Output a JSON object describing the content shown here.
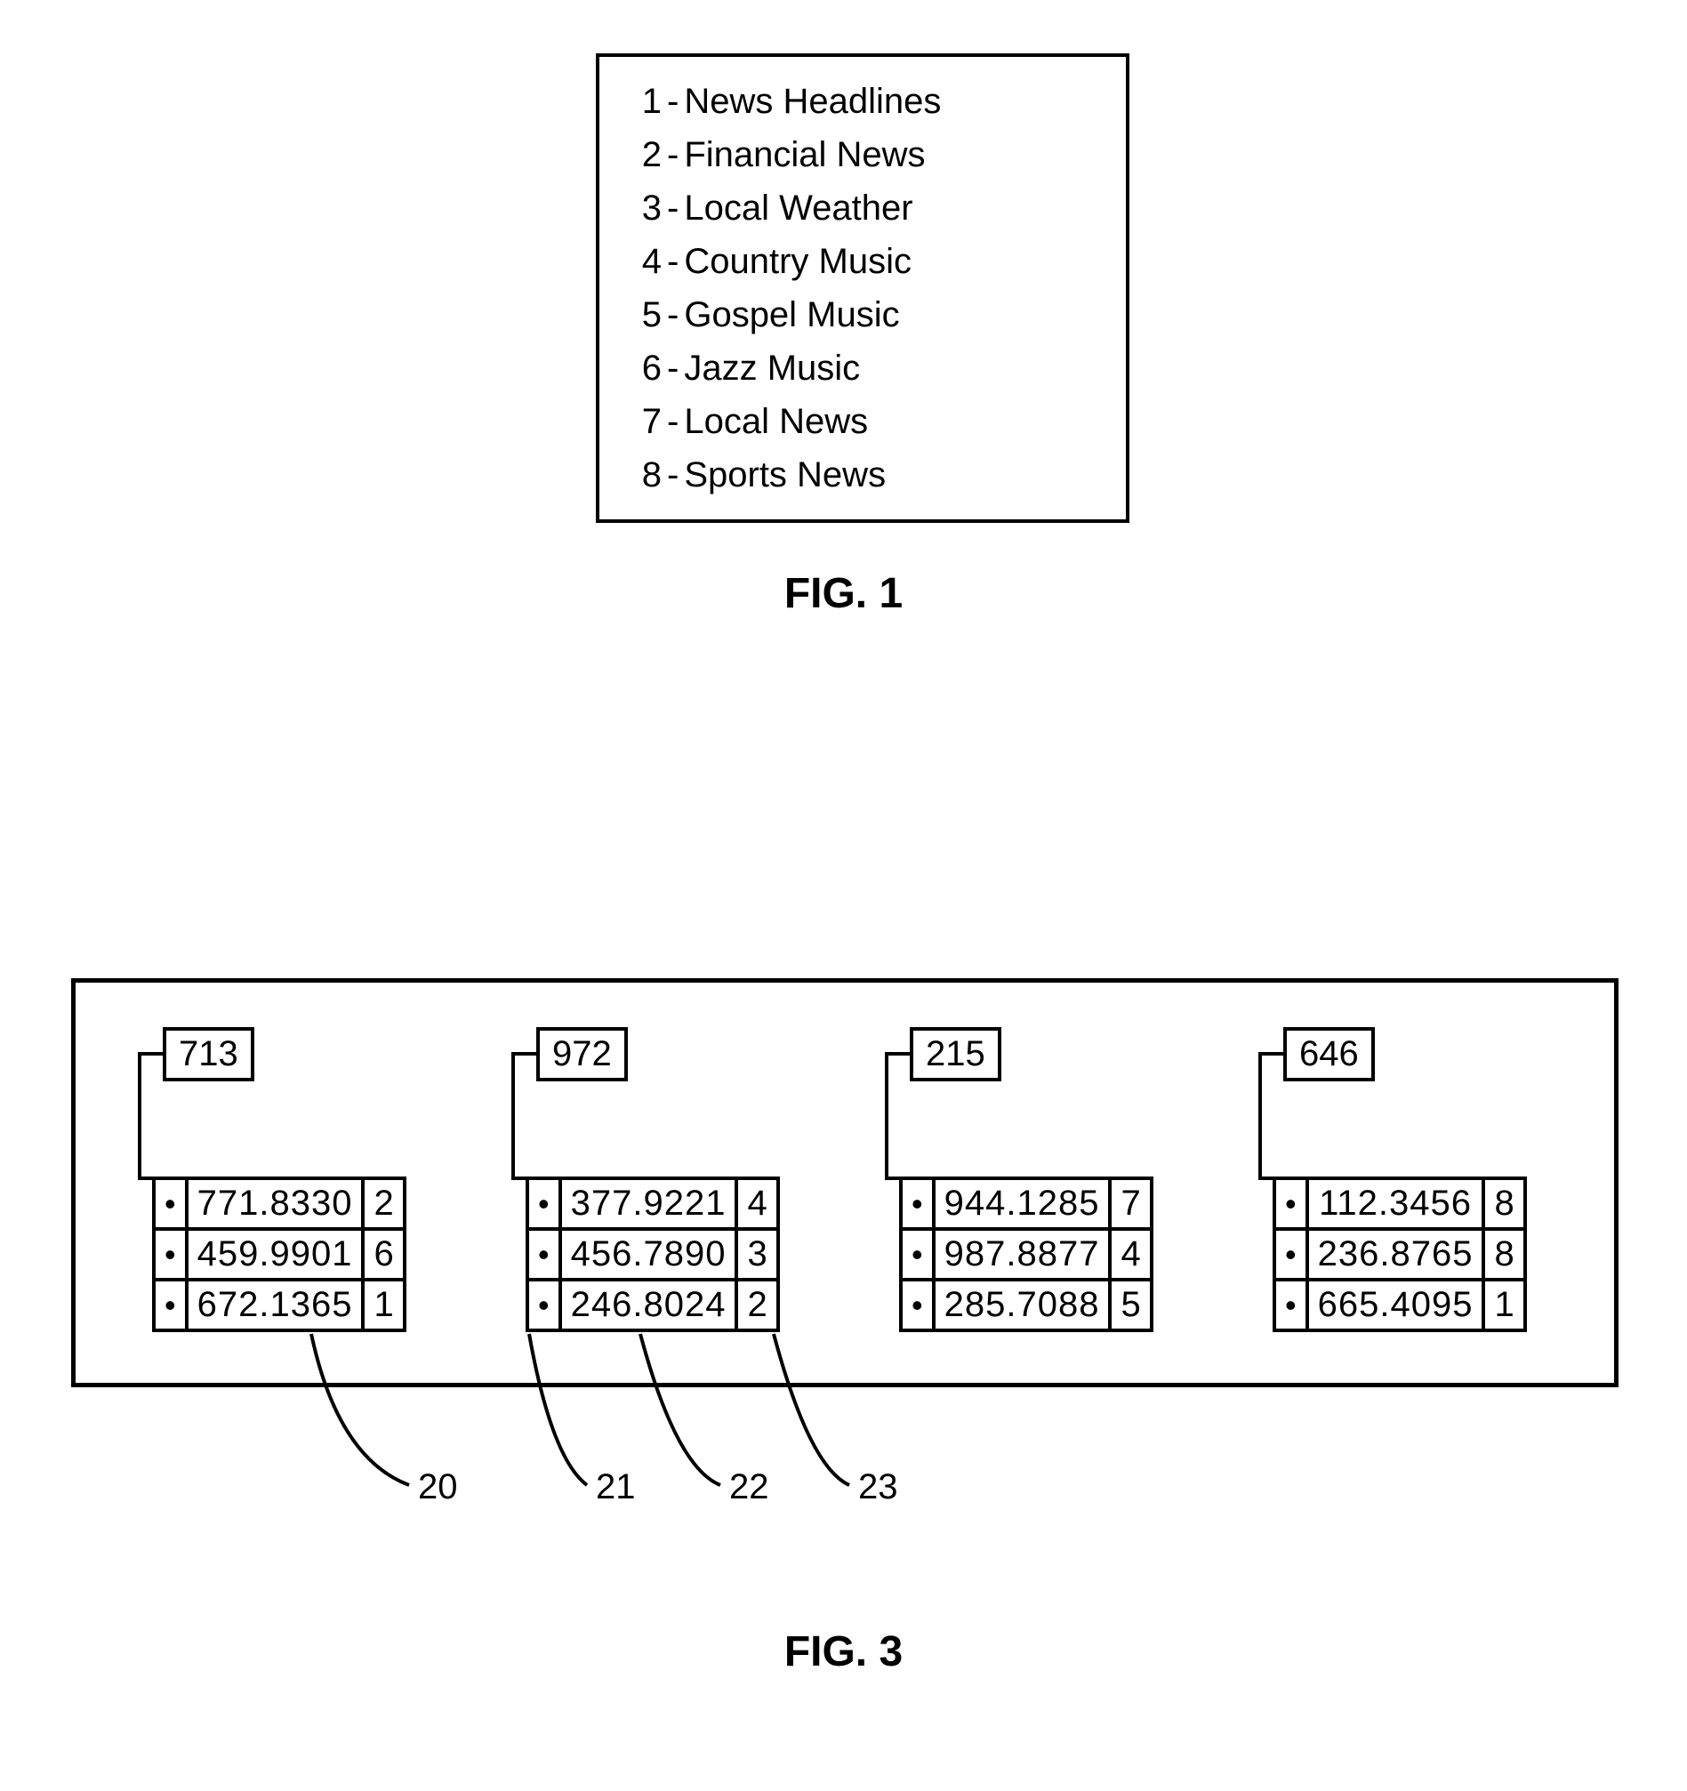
{
  "fig1": {
    "items": [
      {
        "num": "1",
        "label": "News Headlines"
      },
      {
        "num": "2",
        "label": "Financial News"
      },
      {
        "num": "3",
        "label": "Local Weather"
      },
      {
        "num": "4",
        "label": "Country Music"
      },
      {
        "num": "5",
        "label": "Gospel Music"
      },
      {
        "num": "6",
        "label": "Jazz Music"
      },
      {
        "num": "7",
        "label": "Local News"
      },
      {
        "num": "8",
        "label": "Sports News"
      }
    ],
    "caption": "FIG. 1"
  },
  "fig3": {
    "groups": [
      {
        "area": "713",
        "rows": [
          {
            "dot": "•",
            "phone": "771.8330",
            "code": "2"
          },
          {
            "dot": "•",
            "phone": "459.9901",
            "code": "6"
          },
          {
            "dot": "•",
            "phone": "672.1365",
            "code": "1"
          }
        ]
      },
      {
        "area": "972",
        "rows": [
          {
            "dot": "•",
            "phone": "377.9221",
            "code": "4"
          },
          {
            "dot": "•",
            "phone": "456.7890",
            "code": "3"
          },
          {
            "dot": "•",
            "phone": "246.8024",
            "code": "2"
          }
        ]
      },
      {
        "area": "215",
        "rows": [
          {
            "dot": "•",
            "phone": "944.1285",
            "code": "7"
          },
          {
            "dot": "•",
            "phone": "987.8877",
            "code": "4"
          },
          {
            "dot": "•",
            "phone": "285.7088",
            "code": "5"
          }
        ]
      },
      {
        "area": "646",
        "rows": [
          {
            "dot": "•",
            "phone": "112.3456",
            "code": "8"
          },
          {
            "dot": "•",
            "phone": "236.8765",
            "code": "8"
          },
          {
            "dot": "•",
            "phone": "665.4095",
            "code": "1"
          }
        ]
      }
    ],
    "caption": "FIG. 3",
    "refs": {
      "r20": "20",
      "r21": "21",
      "r22": "22",
      "r23": "23"
    }
  }
}
